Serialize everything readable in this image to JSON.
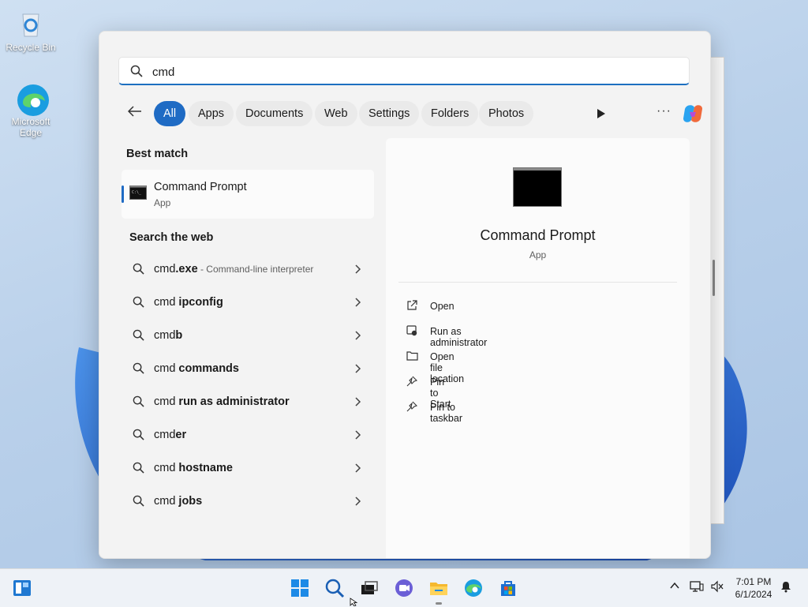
{
  "desktop": {
    "icons": [
      {
        "label": "Recycle Bin",
        "icon": "recycle-bin-icon"
      },
      {
        "label": "Microsoft Edge",
        "icon": "edge-icon"
      }
    ]
  },
  "search": {
    "query": "cmd",
    "filters": [
      "All",
      "Apps",
      "Documents",
      "Web",
      "Settings",
      "Folders",
      "Photos"
    ],
    "active_filter": "All"
  },
  "best_match": {
    "section_label": "Best match",
    "name": "Command Prompt",
    "type": "App"
  },
  "web": {
    "section_label": "Search the web",
    "items": [
      {
        "prefix": "cmd",
        "bold": ".exe",
        "desc": " - Command-line interpreter"
      },
      {
        "prefix": "cmd ",
        "bold": "ipconfig",
        "desc": ""
      },
      {
        "prefix": "cmd",
        "bold": "b",
        "desc": ""
      },
      {
        "prefix": "cmd ",
        "bold": "commands",
        "desc": ""
      },
      {
        "prefix": "cmd ",
        "bold": "run as administrator",
        "desc": ""
      },
      {
        "prefix": "cmd",
        "bold": "er",
        "desc": ""
      },
      {
        "prefix": "cmd ",
        "bold": "hostname",
        "desc": ""
      },
      {
        "prefix": "cmd ",
        "bold": "jobs",
        "desc": ""
      }
    ]
  },
  "details": {
    "title": "Command Prompt",
    "subtitle": "App",
    "actions": [
      {
        "label": "Open",
        "icon": "open-external-icon"
      },
      {
        "label": "Run as administrator",
        "icon": "shield-admin-icon"
      },
      {
        "label": "Open file location",
        "icon": "folder-icon"
      },
      {
        "label": "Pin to Start",
        "icon": "pin-icon"
      },
      {
        "label": "Pin to taskbar",
        "icon": "pin-icon"
      }
    ]
  },
  "taskbar": {
    "time": "7:01 PM",
    "date": "6/1/2024"
  },
  "colors": {
    "accent": "#1f6bc4"
  }
}
